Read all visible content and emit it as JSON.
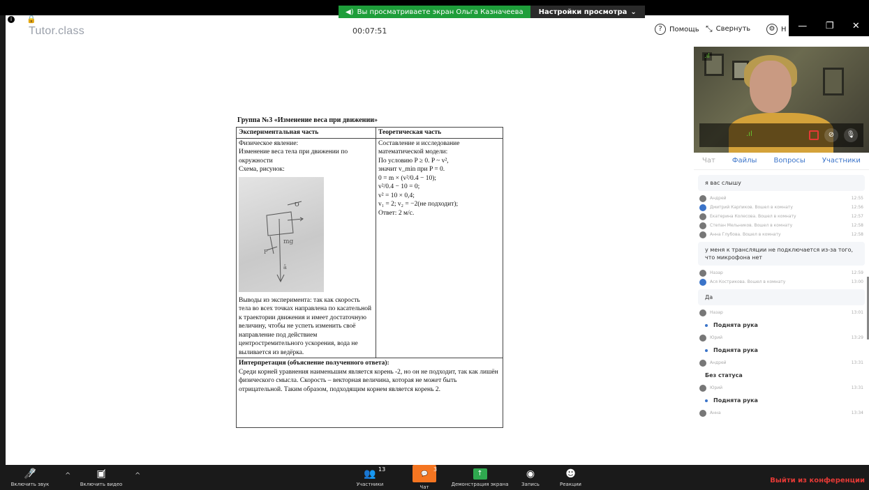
{
  "share_banner": {
    "viewing_text": "Вы просматриваете экран Ольга Казначеева",
    "view_settings": "Настройки просмотра"
  },
  "header": {
    "logo": "Tutor.class",
    "timer": "00:07:51",
    "help": "Помощь",
    "collapse": "Свернуть",
    "settings_partial": "Н"
  },
  "document": {
    "title": "Группа №3 «Изменение веса при движении»",
    "col_experimental": "Экспериментальная часть",
    "col_theoretical": "Теоретическая часть",
    "exp_lines": [
      "Физическое явление:",
      "Изменение веса тела при движении по окружности",
      "Схема, рисунок:"
    ],
    "conclusions": "Выводы из эксперимента: так как скорость тела во всех точках направлена по касательной к траектории движения и имеет достаточную величину, чтобы не успеть изменить своё направление под действием центростремительного ускорения, вода не выливается из ведёрка.",
    "theory_lines": [
      "Составление и исследование математической модели:",
      "По условию P ≥ 0.  P ~ v²,",
      "значит v_min при P = 0.",
      "0 = m × (v²/0.4 − 10);",
      "v²/0.4 − 10 = 0;",
      "v² = 10 × 0,4;",
      "v₁ = 2; v₂ = −2(не подходит);",
      "Ответ: 2 м/с."
    ],
    "interpretation_title": "Интерпретация (объяснение полученного ответа):",
    "interpretation_text": "Среди корней уравнения наименьшим является корень -2, но он не подходит, так как лишён физического смысла. Скорость – векторная величина, которая не может быть отрицательной. Таким образом, подходящим корнем является корень 2."
  },
  "tabs": {
    "chat": "Чат",
    "files": "Файлы",
    "questions": "Вопросы",
    "participants": "Участники"
  },
  "chat": {
    "msg1": "я вас слышу",
    "log1": [
      {
        "name": "Андрей",
        "time": "12:55"
      },
      {
        "name": "Дмитрий Карпиков. Вошел в комнату",
        "time": "12:56"
      },
      {
        "name": "Екатерина Колесова. Вошел в комнату",
        "time": "12:57"
      },
      {
        "name": "Степан Мельников. Вошел в комнату",
        "time": "12:58"
      },
      {
        "name": "Анна Глубова. Вошел в комнату",
        "time": "12:58"
      }
    ],
    "msg2": "у меня к трансляции не подключается из-за того, что микрофона нет",
    "log2": [
      {
        "name": "Назар",
        "time": "12:59"
      },
      {
        "name": "Ася Кострикова. Вошел в комнату",
        "time": "13:00"
      }
    ],
    "msg3": "Да",
    "log3": {
      "name": "Назар",
      "time": "13:01"
    },
    "raised_hand": "Поднята рука",
    "log4": {
      "name": "Юрий",
      "time": "13:29"
    },
    "log5": {
      "name": "Андрей",
      "time": "13:31"
    },
    "no_status": "Без статуса",
    "log6": {
      "name": "Юрий",
      "time": "13:31"
    },
    "log7": {
      "name": "Анна",
      "time": "13:34"
    }
  },
  "toolbar": {
    "sound": "Включить звук",
    "video": "Включить видео",
    "participants": "Участники",
    "participants_count": "13",
    "chat": "Чат",
    "chat_count": "3",
    "screen_share": "Демонстрация экрана",
    "record": "Запись",
    "reactions": "Реакции",
    "exit": "Выйти из конференции"
  },
  "colors": {
    "accent": "#3b74c9",
    "chat_active": "#f47521",
    "share_green": "#2fa84f",
    "exit_red": "#e53935"
  }
}
